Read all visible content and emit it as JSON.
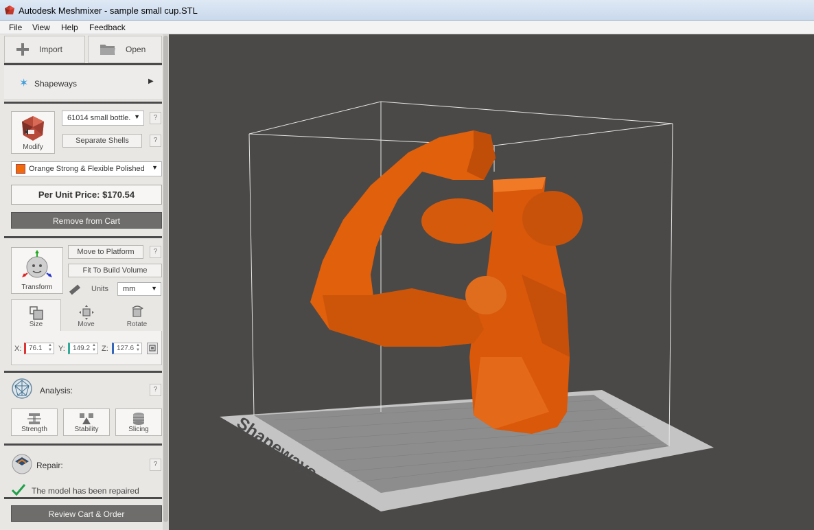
{
  "window": {
    "title": "Autodesk Meshmixer - sample small cup.STL"
  },
  "menu": {
    "items": [
      "File",
      "View",
      "Help",
      "Feedback"
    ]
  },
  "toolbar": {
    "import_label": "Import",
    "open_label": "Open"
  },
  "shapeways": {
    "label": "Shapeways"
  },
  "modify": {
    "label": "Modify",
    "model_select": "61014 small bottle.",
    "separate_shells_label": "Separate Shells",
    "help": "?",
    "material_select": "Orange Strong & Flexible Polished",
    "material_color": "#f06a0a",
    "price": "Per Unit Price: $170.54",
    "remove_label": "Remove from Cart"
  },
  "transform": {
    "label": "Transform",
    "move_to_platform_label": "Move to Platform",
    "fit_to_build_label": "Fit To Build Volume",
    "units_label": "Units",
    "units_value": "mm",
    "tabs": [
      "Size",
      "Move",
      "Rotate"
    ],
    "x_label": "X:",
    "y_label": "Y:",
    "z_label": "Z:",
    "x_value": "76.1",
    "y_value": "149.2",
    "z_value": "127.6"
  },
  "analysis": {
    "label": "Analysis:",
    "buttons": [
      "Strength",
      "Stability",
      "Slicing"
    ]
  },
  "repair": {
    "label": "Repair:",
    "status": "The model has been repaired"
  },
  "footer": {
    "review_label": "Review Cart & Order"
  },
  "viewport": {
    "platform_text": "Shapeways",
    "model_color": "#e0600c",
    "background_color": "#4b4947"
  }
}
